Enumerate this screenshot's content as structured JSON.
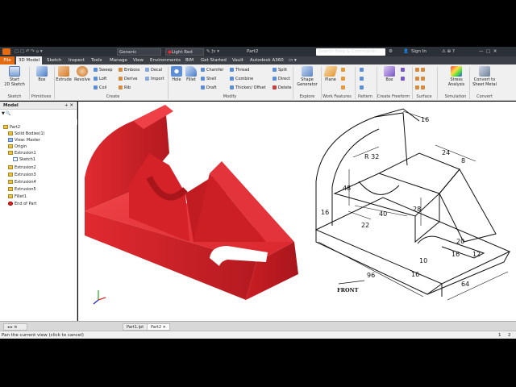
{
  "titlebar": {
    "material": "Generic",
    "appearance": "Light Red",
    "doc_title": "Part2",
    "search_placeholder": "Search Help & Commands...",
    "sign_in": "Sign In"
  },
  "menu_tabs": [
    {
      "label": "File"
    },
    {
      "label": "3D Model"
    },
    {
      "label": "Sketch"
    },
    {
      "label": "Inspect"
    },
    {
      "label": "Tools"
    },
    {
      "label": "Manage"
    },
    {
      "label": "View"
    },
    {
      "label": "Environments"
    },
    {
      "label": "BIM"
    },
    {
      "label": "Get Started"
    },
    {
      "label": "Vault"
    },
    {
      "label": "Autodesk A360"
    }
  ],
  "ribbon": {
    "sketch": {
      "start_label": "Start",
      "start_label2": "2D Sketch",
      "group": "Sketch"
    },
    "primitives": {
      "box": "Box",
      "group": "Primitives"
    },
    "create": {
      "extrude": "Extrude",
      "revolve": "Revolve",
      "sweep": "Sweep",
      "loft": "Loft",
      "coil": "Coil",
      "emboss": "Emboss",
      "derive": "Derive",
      "rib": "Rib",
      "decal": "Decal",
      "import": "Import",
      "group": "Create"
    },
    "modify": {
      "hole": "Hole",
      "fillet": "Fillet",
      "chamfer": "Chamfer",
      "shell": "Shell",
      "draft": "Draft",
      "thread": "Thread",
      "combine": "Combine",
      "thicken": "Thicken/ Offset",
      "split": "Split",
      "direct": "Direct",
      "delete": "Delete",
      "group": "Modify"
    },
    "explore": {
      "shape1": "Shape",
      "shape2": "Generator",
      "group": "Explore"
    },
    "work": {
      "plane": "Plane",
      "group": "Work Features"
    },
    "pattern": {
      "group": "Pattern"
    },
    "freeform": {
      "box": "Box",
      "group": "Create Freeform"
    },
    "surface": {
      "group": "Surface"
    },
    "simulation": {
      "stress1": "Stress",
      "stress2": "Analysis",
      "group": "Simulation"
    },
    "convert": {
      "c1": "Convert to",
      "c2": "Sheet Metal",
      "group": "Convert"
    }
  },
  "browser": {
    "title": "Model",
    "items": [
      {
        "label": "Part2"
      },
      {
        "label": "Solid Bodies(1)"
      },
      {
        "label": "View: Master"
      },
      {
        "label": "Origin"
      },
      {
        "label": "Extrusion1"
      },
      {
        "label": "Sketch1"
      },
      {
        "label": "Extrusion2"
      },
      {
        "label": "Extrusion3"
      },
      {
        "label": "Extrusion4"
      },
      {
        "label": "Extrusion5"
      },
      {
        "label": "Fillet1"
      },
      {
        "label": "End of Part"
      }
    ]
  },
  "drawing": {
    "dims": {
      "d16_top": "16",
      "r32": "R 32",
      "d24": "24",
      "d8": "8",
      "d48": "48",
      "d16_left": "16",
      "d40": "40",
      "d28": "28",
      "d22": "22",
      "d20": "20",
      "d12": "12",
      "d16_mid": "16",
      "d10": "10",
      "d96": "96",
      "d16_bot": "16",
      "d64": "64"
    },
    "front_label": "FRONT"
  },
  "doc_tabs": [
    {
      "label": "Part1.ipt"
    },
    {
      "label": "Part2"
    }
  ],
  "status": {
    "message": "Pan the current view (click to cancel)",
    "n1": "1",
    "n2": "2"
  },
  "colors": {
    "model_red": "#e8262d",
    "file_tab": "#e46b12"
  }
}
